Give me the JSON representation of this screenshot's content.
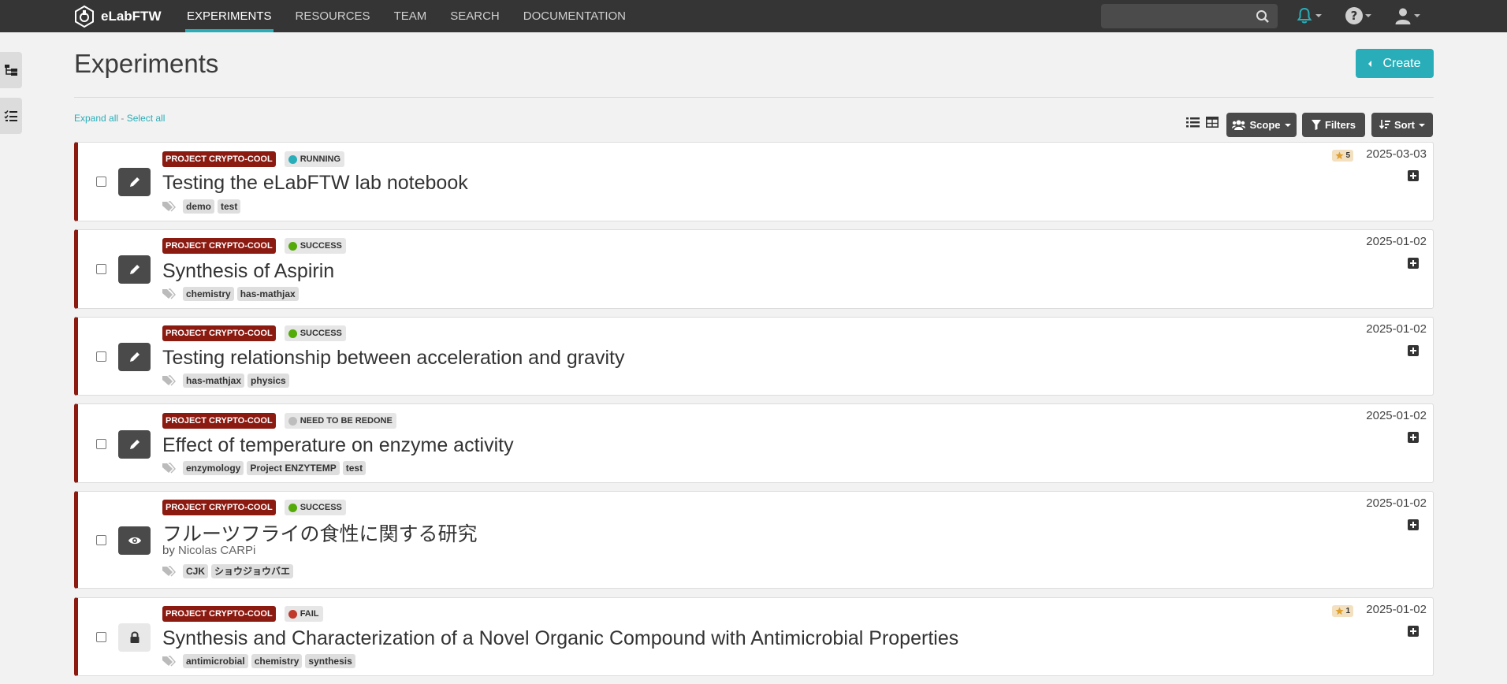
{
  "app": {
    "name": "eLabFTW"
  },
  "nav": {
    "links": [
      {
        "label": "EXPERIMENTS",
        "active": true
      },
      {
        "label": "RESOURCES",
        "active": false
      },
      {
        "label": "TEAM",
        "active": false
      },
      {
        "label": "SEARCH",
        "active": false
      },
      {
        "label": "DOCUMENTATION",
        "active": false
      }
    ],
    "search_value": "",
    "icons": [
      "bell-icon",
      "question-circle-icon",
      "user-icon"
    ]
  },
  "page": {
    "title": "Experiments",
    "create_label": "Create",
    "expand_all": "Expand all",
    "separator": " - ",
    "select_all": "Select all"
  },
  "toolbar": {
    "scope_label": "Scope",
    "filters_label": "Filters",
    "sort_label": "Sort"
  },
  "colors": {
    "accent": "#29aeb9",
    "category": "#8b1a11",
    "running": "#29aeb9",
    "success": "#54aa08",
    "redo": "#bdbdbd",
    "fail": "#c0392b"
  },
  "experiments": [
    {
      "category": "PROJECT CRYPTO-COOL",
      "status": "RUNNING",
      "status_color": "#29aeb9",
      "title": "Testing the eLabFTW lab notebook",
      "tags": [
        "demo",
        "test"
      ],
      "date": "2025-03-03",
      "rating": "5",
      "action_icon": "pencil-icon",
      "locked": false
    },
    {
      "category": "PROJECT CRYPTO-COOL",
      "status": "SUCCESS",
      "status_color": "#54aa08",
      "title": "Synthesis of Aspirin",
      "tags": [
        "chemistry",
        "has-mathjax"
      ],
      "date": "2025-01-02",
      "action_icon": "pencil-icon",
      "locked": false
    },
    {
      "category": "PROJECT CRYPTO-COOL",
      "status": "SUCCESS",
      "status_color": "#54aa08",
      "title": "Testing relationship between acceleration and gravity",
      "tags": [
        "has-mathjax",
        "physics"
      ],
      "date": "2025-01-02",
      "action_icon": "pencil-icon",
      "locked": false
    },
    {
      "category": "PROJECT CRYPTO-COOL",
      "status": "NEED TO BE REDONE",
      "status_color": "#bdbdbd",
      "title": "Effect of temperature on enzyme activity",
      "tags": [
        "enzymology",
        "Project ENZYTEMP",
        "test"
      ],
      "date": "2025-01-02",
      "action_icon": "pencil-icon",
      "locked": false
    },
    {
      "category": "PROJECT CRYPTO-COOL",
      "status": "SUCCESS",
      "status_color": "#54aa08",
      "title": "フルーツフライの食性に関する研究",
      "author_prefix": "by",
      "author": "Nicolas CARPi",
      "tags": [
        "CJK",
        "ショウジョウバエ"
      ],
      "date": "2025-01-02",
      "action_icon": "eye-icon",
      "locked": false
    },
    {
      "category": "PROJECT CRYPTO-COOL",
      "status": "FAIL",
      "status_color": "#c0392b",
      "title": "Synthesis and Characterization of a Novel Organic Compound with Antimicrobial Properties",
      "tags": [
        "antimicrobial",
        "chemistry",
        "synthesis"
      ],
      "date": "2025-01-02",
      "rating": "1",
      "action_icon": "lock-icon",
      "locked": true
    }
  ]
}
